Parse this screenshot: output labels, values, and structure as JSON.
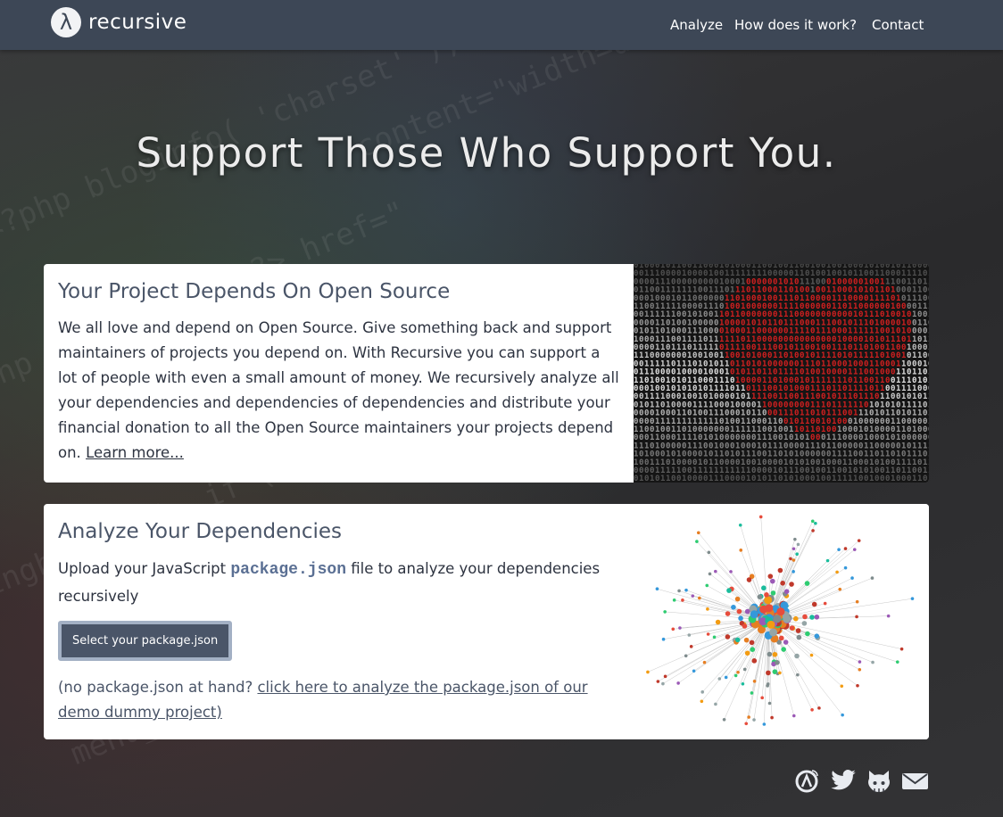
{
  "brand": {
    "logo_glyph": "λ",
    "name": "recursive"
  },
  "nav": {
    "items": [
      "Analyze",
      "How does it work?",
      "Contact"
    ]
  },
  "hero": {
    "title": "Support Those Who Support You."
  },
  "card1": {
    "title": "Your Project Depends On Open Source",
    "text": "We all love and depend on Open Source. Give something back and support maintainers of projects you depend on. With Recursive you can support a lot of people with even a small amount of money. We recursively analyze all your dependencies and dependencies of dependencies and distribute your financial donation to all the Open Source maintainers your projects depend on.",
    "link": "Learn more..."
  },
  "card2": {
    "title": "Analyze Your Dependencies",
    "text_before": "Upload your JavaScript",
    "code": "package.json",
    "text_after": "file to analyze your dependencies recursively",
    "button": "Select your package.json",
    "demo_prefix": "(no package.json at hand?",
    "demo_link": "click here to analyze the package.json of our demo dummy project)"
  },
  "social": [
    "open-collective-icon",
    "twitter-icon",
    "github-icon",
    "mail-icon"
  ],
  "colors": {
    "navbar": "#3d4756",
    "accent": "#4a5568",
    "code": "#5a6f93",
    "heart": "#d42020"
  }
}
